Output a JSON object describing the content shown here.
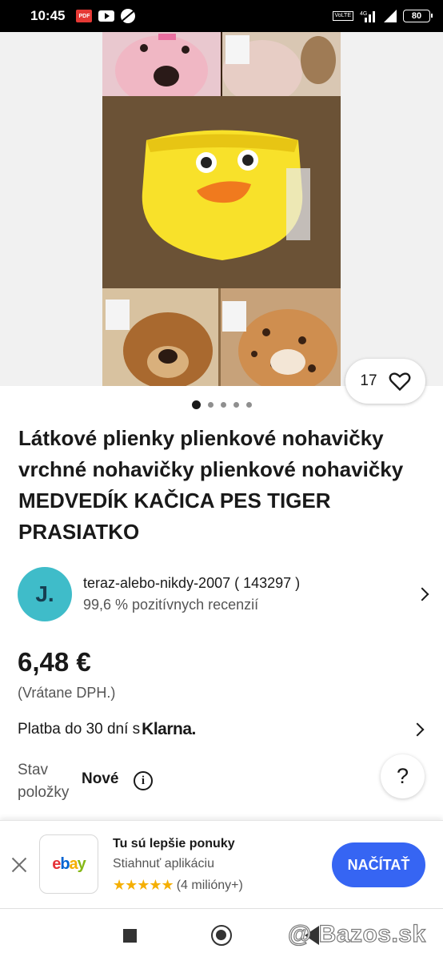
{
  "status_bar": {
    "time": "10:45",
    "pdf_badge": "PDF",
    "volte_label": "VoLTE",
    "network": "4G",
    "battery": "80"
  },
  "gallery": {
    "like_count": "17",
    "page_count": 5,
    "active_page": 1
  },
  "listing": {
    "title": "Látkové plienky plienkové nohavičky vrchné nohavičky plienkové nohavičky MEDVEDÍK KAČICA PES TIGER PRASIATKO",
    "seller_initial": "J.",
    "seller_name": "teraz-alebo-nikdy-2007 ( 143297 )",
    "seller_feedback": "99,6 % pozitívnych recenzií",
    "price": "6,48 €",
    "vat_note": "(Vrátane DPH.)",
    "payment_text": "Platba do 30 dní s",
    "payment_brand": "Klarna.",
    "condition_label": "Stav položky",
    "condition_value": "Nové",
    "help_label": "?"
  },
  "app_banner": {
    "title": "Tu sú lepšie ponuky",
    "subtitle": "Stiahnuť aplikáciu",
    "stars": "★★★★★",
    "rating_count": "(4 milióny+)",
    "install_label": "NAČÍTAŤ",
    "logo": {
      "e": "e",
      "b": "b",
      "a": "a",
      "y": "y"
    }
  },
  "watermark": "@ Bazos.sk",
  "colors": {
    "accent": "#3665f3",
    "avatar": "#3fbcc9",
    "stars": "#f5af02"
  }
}
